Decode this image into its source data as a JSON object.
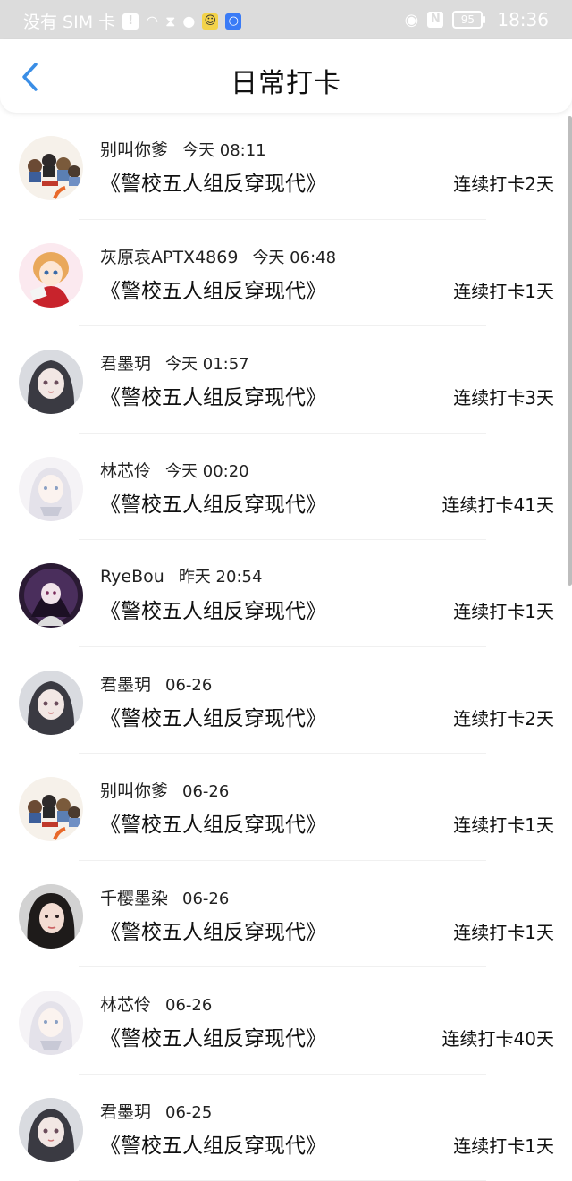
{
  "status_bar": {
    "carrier": "没有 SIM 卡",
    "battery": "95",
    "time": "18:36"
  },
  "header": {
    "title": "日常打卡"
  },
  "checkins": [
    {
      "user": "别叫你爹",
      "time": "今天 08:11",
      "book": "《警校五人组反穿现代》",
      "streak": "连续打卡2天",
      "avatar": "group-chibi"
    },
    {
      "user": "灰原哀APTX4869",
      "time": "今天 06:48",
      "book": "《警校五人组反穿现代》",
      "streak": "连续打卡1天",
      "avatar": "anime-red"
    },
    {
      "user": "君墨玥",
      "time": "今天 01:57",
      "book": "《警校五人组反穿现代》",
      "streak": "连续打卡3天",
      "avatar": "anime-dark"
    },
    {
      "user": "林芯伶",
      "time": "今天 00:20",
      "book": "《警校五人组反穿现代》",
      "streak": "连续打卡41天",
      "avatar": "anime-white"
    },
    {
      "user": "RyeBou",
      "time": "昨天 20:54",
      "book": "《警校五人组反穿现代》",
      "streak": "连续打卡1天",
      "avatar": "anime-purple"
    },
    {
      "user": "君墨玥",
      "time": "06-26",
      "book": "《警校五人组反穿现代》",
      "streak": "连续打卡2天",
      "avatar": "anime-dark"
    },
    {
      "user": "别叫你爹",
      "time": "06-26",
      "book": "《警校五人组反穿现代》",
      "streak": "连续打卡1天",
      "avatar": "group-chibi"
    },
    {
      "user": "千樱墨染",
      "time": "06-26",
      "book": "《警校五人组反穿现代》",
      "streak": "连续打卡1天",
      "avatar": "photo-girl"
    },
    {
      "user": "林芯伶",
      "time": "06-26",
      "book": "《警校五人组反穿现代》",
      "streak": "连续打卡40天",
      "avatar": "anime-white"
    },
    {
      "user": "君墨玥",
      "time": "06-25",
      "book": "《警校五人组反穿现代》",
      "streak": "连续打卡1天",
      "avatar": "anime-dark"
    }
  ]
}
